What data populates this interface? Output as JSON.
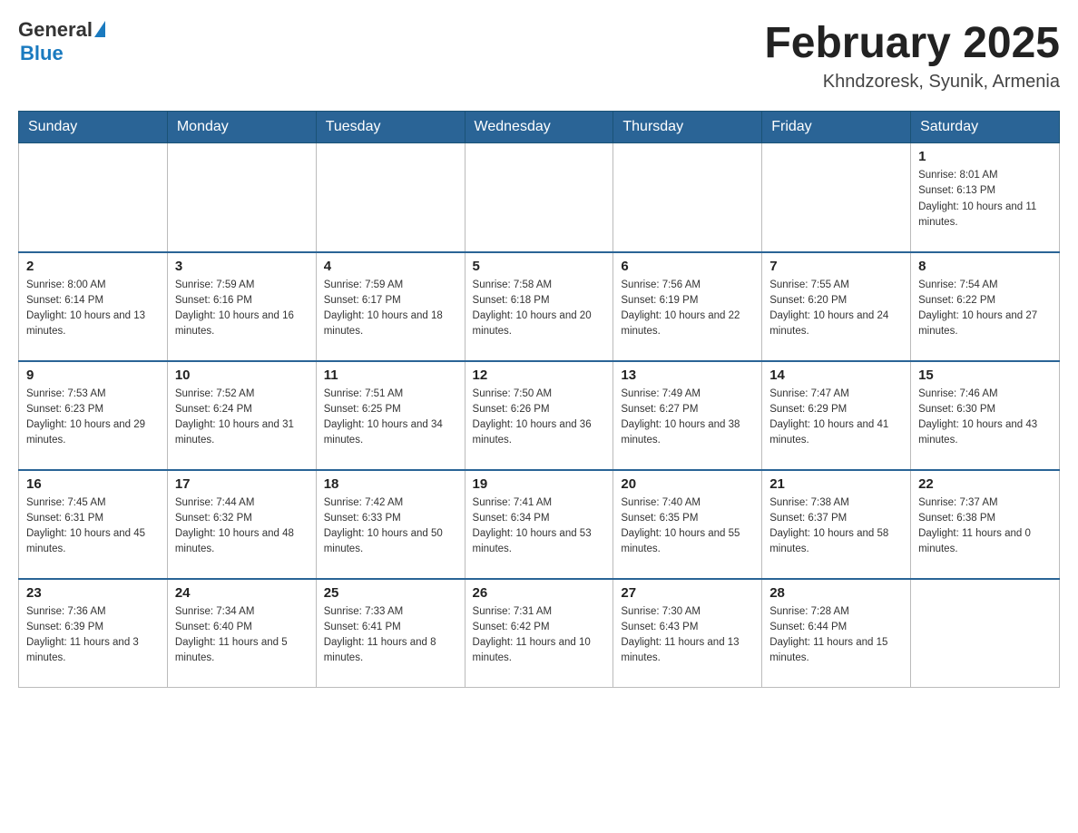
{
  "header": {
    "logo_general": "General",
    "logo_blue": "Blue",
    "title": "February 2025",
    "location": "Khndzoresk, Syunik, Armenia"
  },
  "days_of_week": [
    "Sunday",
    "Monday",
    "Tuesday",
    "Wednesday",
    "Thursday",
    "Friday",
    "Saturday"
  ],
  "weeks": [
    [
      null,
      null,
      null,
      null,
      null,
      null,
      {
        "day": "1",
        "sunrise": "Sunrise: 8:01 AM",
        "sunset": "Sunset: 6:13 PM",
        "daylight": "Daylight: 10 hours and 11 minutes."
      }
    ],
    [
      {
        "day": "2",
        "sunrise": "Sunrise: 8:00 AM",
        "sunset": "Sunset: 6:14 PM",
        "daylight": "Daylight: 10 hours and 13 minutes."
      },
      {
        "day": "3",
        "sunrise": "Sunrise: 7:59 AM",
        "sunset": "Sunset: 6:16 PM",
        "daylight": "Daylight: 10 hours and 16 minutes."
      },
      {
        "day": "4",
        "sunrise": "Sunrise: 7:59 AM",
        "sunset": "Sunset: 6:17 PM",
        "daylight": "Daylight: 10 hours and 18 minutes."
      },
      {
        "day": "5",
        "sunrise": "Sunrise: 7:58 AM",
        "sunset": "Sunset: 6:18 PM",
        "daylight": "Daylight: 10 hours and 20 minutes."
      },
      {
        "day": "6",
        "sunrise": "Sunrise: 7:56 AM",
        "sunset": "Sunset: 6:19 PM",
        "daylight": "Daylight: 10 hours and 22 minutes."
      },
      {
        "day": "7",
        "sunrise": "Sunrise: 7:55 AM",
        "sunset": "Sunset: 6:20 PM",
        "daylight": "Daylight: 10 hours and 24 minutes."
      },
      {
        "day": "8",
        "sunrise": "Sunrise: 7:54 AM",
        "sunset": "Sunset: 6:22 PM",
        "daylight": "Daylight: 10 hours and 27 minutes."
      }
    ],
    [
      {
        "day": "9",
        "sunrise": "Sunrise: 7:53 AM",
        "sunset": "Sunset: 6:23 PM",
        "daylight": "Daylight: 10 hours and 29 minutes."
      },
      {
        "day": "10",
        "sunrise": "Sunrise: 7:52 AM",
        "sunset": "Sunset: 6:24 PM",
        "daylight": "Daylight: 10 hours and 31 minutes."
      },
      {
        "day": "11",
        "sunrise": "Sunrise: 7:51 AM",
        "sunset": "Sunset: 6:25 PM",
        "daylight": "Daylight: 10 hours and 34 minutes."
      },
      {
        "day": "12",
        "sunrise": "Sunrise: 7:50 AM",
        "sunset": "Sunset: 6:26 PM",
        "daylight": "Daylight: 10 hours and 36 minutes."
      },
      {
        "day": "13",
        "sunrise": "Sunrise: 7:49 AM",
        "sunset": "Sunset: 6:27 PM",
        "daylight": "Daylight: 10 hours and 38 minutes."
      },
      {
        "day": "14",
        "sunrise": "Sunrise: 7:47 AM",
        "sunset": "Sunset: 6:29 PM",
        "daylight": "Daylight: 10 hours and 41 minutes."
      },
      {
        "day": "15",
        "sunrise": "Sunrise: 7:46 AM",
        "sunset": "Sunset: 6:30 PM",
        "daylight": "Daylight: 10 hours and 43 minutes."
      }
    ],
    [
      {
        "day": "16",
        "sunrise": "Sunrise: 7:45 AM",
        "sunset": "Sunset: 6:31 PM",
        "daylight": "Daylight: 10 hours and 45 minutes."
      },
      {
        "day": "17",
        "sunrise": "Sunrise: 7:44 AM",
        "sunset": "Sunset: 6:32 PM",
        "daylight": "Daylight: 10 hours and 48 minutes."
      },
      {
        "day": "18",
        "sunrise": "Sunrise: 7:42 AM",
        "sunset": "Sunset: 6:33 PM",
        "daylight": "Daylight: 10 hours and 50 minutes."
      },
      {
        "day": "19",
        "sunrise": "Sunrise: 7:41 AM",
        "sunset": "Sunset: 6:34 PM",
        "daylight": "Daylight: 10 hours and 53 minutes."
      },
      {
        "day": "20",
        "sunrise": "Sunrise: 7:40 AM",
        "sunset": "Sunset: 6:35 PM",
        "daylight": "Daylight: 10 hours and 55 minutes."
      },
      {
        "day": "21",
        "sunrise": "Sunrise: 7:38 AM",
        "sunset": "Sunset: 6:37 PM",
        "daylight": "Daylight: 10 hours and 58 minutes."
      },
      {
        "day": "22",
        "sunrise": "Sunrise: 7:37 AM",
        "sunset": "Sunset: 6:38 PM",
        "daylight": "Daylight: 11 hours and 0 minutes."
      }
    ],
    [
      {
        "day": "23",
        "sunrise": "Sunrise: 7:36 AM",
        "sunset": "Sunset: 6:39 PM",
        "daylight": "Daylight: 11 hours and 3 minutes."
      },
      {
        "day": "24",
        "sunrise": "Sunrise: 7:34 AM",
        "sunset": "Sunset: 6:40 PM",
        "daylight": "Daylight: 11 hours and 5 minutes."
      },
      {
        "day": "25",
        "sunrise": "Sunrise: 7:33 AM",
        "sunset": "Sunset: 6:41 PM",
        "daylight": "Daylight: 11 hours and 8 minutes."
      },
      {
        "day": "26",
        "sunrise": "Sunrise: 7:31 AM",
        "sunset": "Sunset: 6:42 PM",
        "daylight": "Daylight: 11 hours and 10 minutes."
      },
      {
        "day": "27",
        "sunrise": "Sunrise: 7:30 AM",
        "sunset": "Sunset: 6:43 PM",
        "daylight": "Daylight: 11 hours and 13 minutes."
      },
      {
        "day": "28",
        "sunrise": "Sunrise: 7:28 AM",
        "sunset": "Sunset: 6:44 PM",
        "daylight": "Daylight: 11 hours and 15 minutes."
      },
      null
    ]
  ]
}
